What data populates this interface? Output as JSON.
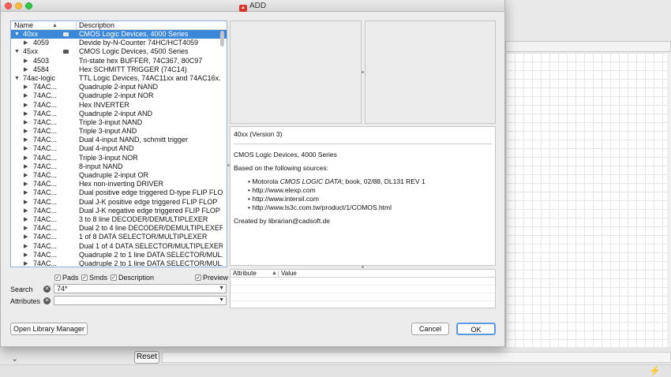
{
  "dialog": {
    "title": "ADD",
    "open_library_manager_label": "Open Library Manager",
    "cancel_label": "Cancel",
    "ok_label": "OK"
  },
  "tree": {
    "col_name": "Name",
    "col_description": "Description",
    "rows": [
      {
        "name": "40xx",
        "desc": "CMOS Logic Devices, 4000 Series",
        "level": 0,
        "expanded": true,
        "selected": true,
        "lib": true
      },
      {
        "name": "4059",
        "desc": "Devide by-N-Counter 74HC/HCT4059",
        "level": 1
      },
      {
        "name": "45xx",
        "desc": "CMOS Logic Devices, 4500 Series",
        "level": 0,
        "expanded": true,
        "lib": true
      },
      {
        "name": "4503",
        "desc": "Tri-state hex BUFFER, 74C367, 80C97",
        "level": 1
      },
      {
        "name": "4584",
        "desc": "Hex SCHMITT TRIGGER (74C14)",
        "level": 1
      },
      {
        "name": "74ac-logic",
        "desc": "TTL Logic Devices, 74AC11xx and 74AC16x.",
        "level": 0,
        "expanded": true
      },
      {
        "name": "74AC...",
        "desc": "Quadruple 2-input NAND",
        "level": 1
      },
      {
        "name": "74AC...",
        "desc": "Quadruple 2-input NOR",
        "level": 1
      },
      {
        "name": "74AC...",
        "desc": "Hex INVERTER",
        "level": 1
      },
      {
        "name": "74AC...",
        "desc": "Quadruple 2-input AND",
        "level": 1
      },
      {
        "name": "74AC...",
        "desc": "Triple 3-input NAND",
        "level": 1
      },
      {
        "name": "74AC...",
        "desc": "Triple 3-input AND",
        "level": 1
      },
      {
        "name": "74AC...",
        "desc": "Dual 4-input NAND, schmitt trigger",
        "level": 1
      },
      {
        "name": "74AC...",
        "desc": "Dual 4-input AND",
        "level": 1
      },
      {
        "name": "74AC...",
        "desc": "Triple 3-input NOR",
        "level": 1
      },
      {
        "name": "74AC...",
        "desc": "8-input NAND",
        "level": 1
      },
      {
        "name": "74AC...",
        "desc": "Quadruple 2-input OR",
        "level": 1
      },
      {
        "name": "74AC...",
        "desc": "Hex non-inverting DRIVER",
        "level": 1
      },
      {
        "name": "74AC...",
        "desc": "Dual positive edge triggered D-type FLIP FLO",
        "level": 1
      },
      {
        "name": "74AC...",
        "desc": "Dual J-K positive edge triggered FLIP FLOP",
        "level": 1
      },
      {
        "name": "74AC...",
        "desc": "Dual J-K negative edge triggered FLIP FLOP",
        "level": 1
      },
      {
        "name": "74AC...",
        "desc": "3 to 8 line DECODER/DEMULTIPLEXER",
        "level": 1
      },
      {
        "name": "74AC...",
        "desc": "Dual 2 to 4 line DECODER/DEMULTIPLEXER",
        "level": 1
      },
      {
        "name": "74AC...",
        "desc": "1 of 8 DATA SELECTOR/MULTIPLEXER",
        "level": 1
      },
      {
        "name": "74AC...",
        "desc": "Dual 1 of 4 DATA SELECTOR/MULTIPLEXER",
        "level": 1
      },
      {
        "name": "74AC...",
        "desc": "Quadruple 2 to 1 line DATA SELECTOR/MUL..",
        "level": 1
      },
      {
        "name": "74AC...",
        "desc": "Quadruple 2 to 1 line DATA SELECTOR/MUL..",
        "level": 1
      }
    ]
  },
  "filters": {
    "pads": "Pads",
    "smds": "Smds",
    "description": "Description",
    "preview": "Preview"
  },
  "search": {
    "label": "Search",
    "value": "74*"
  },
  "attributes": {
    "label": "Attributes",
    "value": ""
  },
  "description": {
    "heading": "40xx (Version 3)",
    "subtitle": "CMOS Logic Devices, 4000 Series",
    "sources_intro": "Based on the following sources:",
    "source1_prefix": "Motorola ",
    "source1_italic": "CMOS LOGIC DATA",
    "source1_suffix": "; book, 02/88, DL131 REV 1",
    "source2": "http://www.elexp.com",
    "source3": "http://www.intersil.com",
    "source4": "http://www.ls3c.com.tw/product/1/COMOS.html",
    "created_by": "Created by librarian@cadsoft.de"
  },
  "attribute_table": {
    "col_attribute": "Attribute",
    "col_value": "Value"
  },
  "background": {
    "reset_label": "Reset"
  },
  "colors": {
    "selection": "#3b88d8",
    "ok_border": "#5a9ae2"
  }
}
